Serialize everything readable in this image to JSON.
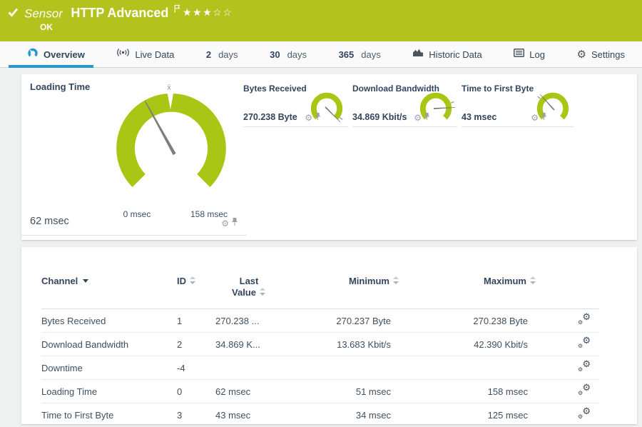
{
  "colors": {
    "header_bg": "#b4c21d",
    "gauge_green": "#a9c614",
    "accent_blue": "#2597d2",
    "text_dark": "#32455c"
  },
  "header": {
    "type_label": "Sensor",
    "title": "HTTP Advanced",
    "status": "OK",
    "stars": {
      "filled": "★★★",
      "empty": "☆☆"
    }
  },
  "tabs": {
    "overview": "Overview",
    "live_data": "Live Data",
    "d2_num": "2",
    "d2_unit": "days",
    "d30_num": "30",
    "d30_unit": "days",
    "d365_num": "365",
    "d365_unit": "days",
    "historic": "Historic Data",
    "log": "Log",
    "settings": "Settings",
    "settings_gear": "⚙"
  },
  "gauges": {
    "primary": {
      "title": "Loading Time",
      "current_value": "62 msec",
      "min_label": "0 msec",
      "max_label": "158 msec",
      "avg_symbol": "x̄",
      "range": [
        0,
        158
      ],
      "current": 62,
      "needle_rotation_deg": -29
    },
    "mini": [
      {
        "title": "Bytes Received",
        "value": "270.238 Byte",
        "needle_rotation_deg": 135,
        "avg_tick_rotation_deg": 125
      },
      {
        "title": "Download Bandwidth",
        "value": "34.869 Kbit/s",
        "needle_rotation_deg": 87,
        "avg_tick_rotation_deg": 70
      },
      {
        "title": "Time to First Byte",
        "value": "43 msec",
        "needle_rotation_deg": -42,
        "avg_tick_rotation_deg": -52
      }
    ],
    "gear_glyph": "⚙"
  },
  "table": {
    "headers": {
      "channel": "Channel",
      "id": "ID",
      "last1": "Last",
      "last2": "Value",
      "minimum": "Minimum",
      "maximum": "Maximum"
    },
    "gear_glyph": "⚙",
    "rows": [
      {
        "channel": "Bytes Received",
        "id": "1",
        "last": "270.238 ...",
        "min": "270.237 Byte",
        "max": "270.238 Byte"
      },
      {
        "channel": "Download Bandwidth",
        "id": "2",
        "last": "34.869 K...",
        "min": "13.683 Kbit/s",
        "max": "42.390 Kbit/s"
      },
      {
        "channel": "Downtime",
        "id": "-4",
        "last": "",
        "min": "",
        "max": ""
      },
      {
        "channel": "Loading Time",
        "id": "0",
        "last": "62 msec",
        "min": "51 msec",
        "max": "158 msec"
      },
      {
        "channel": "Time to First Byte",
        "id": "3",
        "last": "43 msec",
        "min": "34 msec",
        "max": "125 msec"
      }
    ]
  }
}
